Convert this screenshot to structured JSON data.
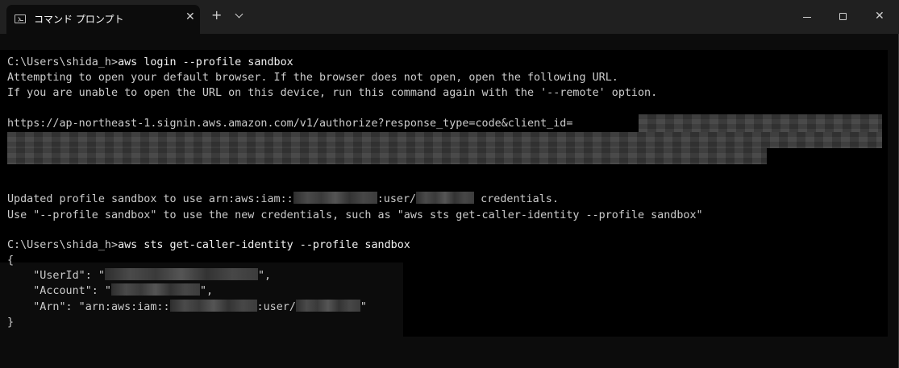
{
  "window": {
    "tab_title": "コマンド プロンプト",
    "tab_close": "✕",
    "new_tab": "+",
    "close_glyph": "✕"
  },
  "terminal": {
    "prompt": "C:\\Users\\shida_h>",
    "cmd1": "aws login --profile sandbox",
    "out1": "Attempting to open your default browser. If the browser does not open, open the following URL.",
    "out2": "If you are unable to open the URL on this device, run this command again with the '--remote' option.",
    "url_prefix": "https://ap-northeast-1.signin.aws.amazon.com/v1/authorize?response_type=code&client_id=",
    "updated_prefix": "Updated profile sandbox to use arn:aws:iam::",
    "updated_mid": ":user/",
    "updated_suffix": " credentials.",
    "use_line": "Use \"--profile sandbox\" to use the new credentials, such as \"aws sts get-caller-identity --profile sandbox\"",
    "cmd2": "aws sts get-caller-identity --profile sandbox",
    "open_brace": "{",
    "userid_prefix": "    \"UserId\": \"",
    "userid_suffix": "\",",
    "account_prefix": "    \"Account\": \"",
    "account_suffix": "\",",
    "arn_prefix": "    \"Arn\": \"arn:aws:iam::",
    "arn_mid": ":user/",
    "arn_suffix": "\"",
    "close_brace": "}"
  }
}
